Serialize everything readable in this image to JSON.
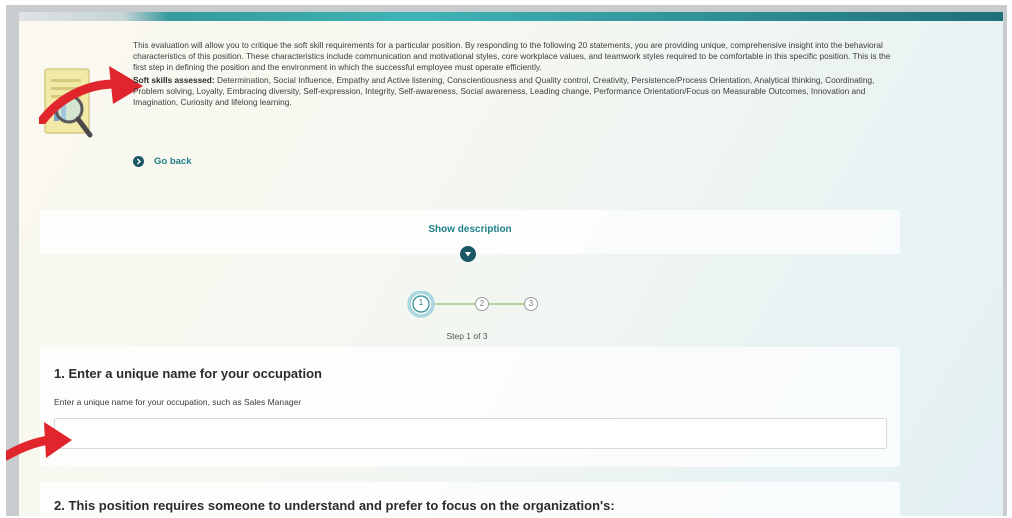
{
  "intro": {
    "paragraph": "This evaluation will allow you to critique the soft skill requirements for a particular position. By responding to the following 20 statements, you are providing unique, comprehensive insight into the behavioral characteristics of this position. These characteristics include communication and motivational styles, core workplace values, and teamwork styles required to be comfortable in this specific position. This is the first step in defining the position and the environment in which the successful employee must operate efficiently.",
    "skills_label": "Soft skills assessed:",
    "skills_list": " Determination, Social Influence, Empathy and Active listening, Conscientiousness and Quality control, Creativity, Persistence/Process Orientation, Analytical thinking, Coordinating, Problem solving, Loyalty, Embracing diversity, Self-expression, Integrity, Self-awareness, Social awareness, Leading change, Performance Orientation/Focus on Measurable Outcomes, Innovation and Imagination, Curiosity and lifelong learning.",
    "go_back": "Go back"
  },
  "description": {
    "show_label": "Show description"
  },
  "stepper": {
    "steps": [
      "1",
      "2",
      "3"
    ],
    "current": 1,
    "label": "Step 1 of 3"
  },
  "question1": {
    "title": "1. Enter a unique name for your occupation",
    "help": "Enter a unique name for your occupation, such as Sales Manager",
    "value": ""
  },
  "question2": {
    "title": "2. This position requires someone to understand and prefer to focus on the organization's:"
  },
  "colors": {
    "accent": "#1f7f88",
    "accent_dark": "#1a5866",
    "arrow": "#e0262c",
    "step_line": "#8fbf6a"
  },
  "icons": {
    "intro": "document-magnifier-icon",
    "go_back": "circle-chevron-right-icon",
    "toggle": "circle-chevron-down-icon"
  }
}
